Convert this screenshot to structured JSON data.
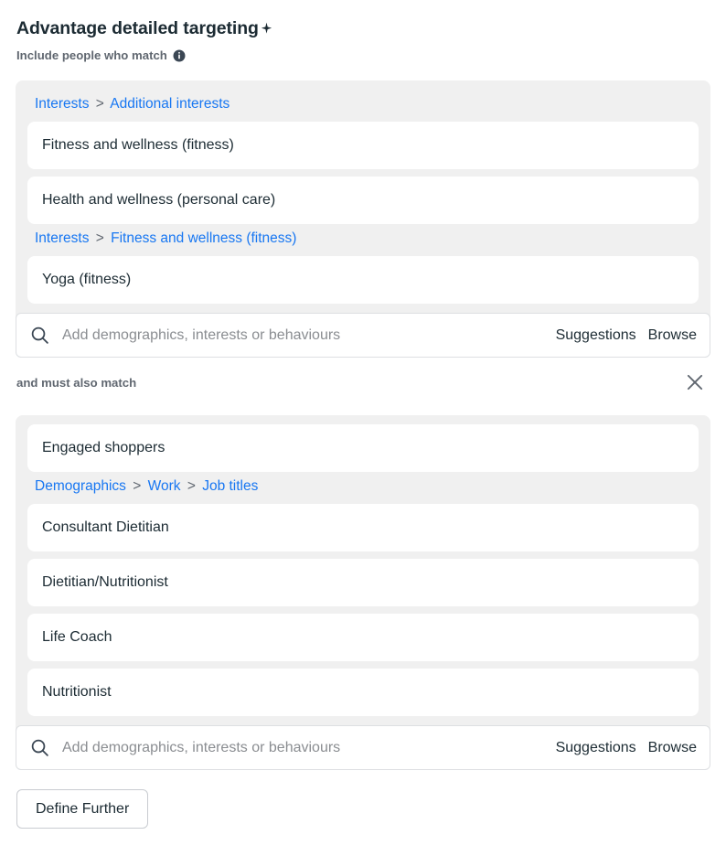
{
  "header": {
    "title": "Advantage detailed targeting",
    "sparkle_icon": "sparkle-icon",
    "subtitle": "Include people who match",
    "info_icon": "info-icon"
  },
  "include_group": {
    "sections": [
      {
        "breadcrumb": [
          "Interests",
          "Additional interests"
        ],
        "items": [
          "Fitness and wellness (fitness)",
          "Health and wellness (personal care)"
        ]
      },
      {
        "breadcrumb": [
          "Interests",
          "Fitness and wellness (fitness)"
        ],
        "items": [
          "Yoga (fitness)"
        ]
      }
    ],
    "search": {
      "icon": "search-icon",
      "value": "",
      "placeholder": "Add demographics, interests or behaviours",
      "suggestions_label": "Suggestions",
      "browse_label": "Browse"
    }
  },
  "narrow_row": {
    "label": "and must also match",
    "close_icon": "close-icon"
  },
  "narrow_group": {
    "sections": [
      {
        "breadcrumb": [],
        "items": [
          "Engaged shoppers"
        ]
      },
      {
        "breadcrumb": [
          "Demographics",
          "Work",
          "Job titles"
        ],
        "items": [
          "Consultant Dietitian",
          "Dietitian/Nutritionist",
          "Life Coach",
          "Nutritionist"
        ]
      }
    ],
    "search": {
      "icon": "search-icon",
      "value": "",
      "placeholder": "Add demographics, interests or behaviours",
      "suggestions_label": "Suggestions",
      "browse_label": "Browse"
    }
  },
  "footer": {
    "define_further_label": "Define Further"
  },
  "colors": {
    "link": "#1877f2",
    "panel_bg": "#f0f0f0",
    "chip_bg": "#ffffff",
    "text": "#1c2b33",
    "muted": "#606770",
    "placeholder": "#8a8d91",
    "border": "#dddfe2"
  },
  "separator": ">"
}
